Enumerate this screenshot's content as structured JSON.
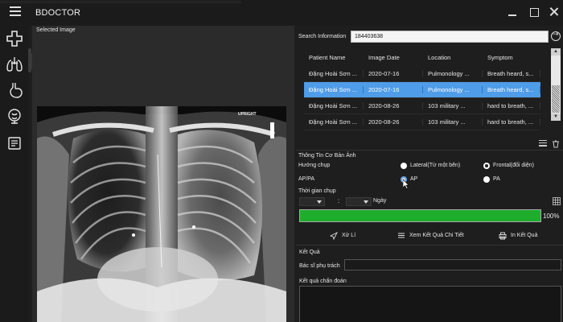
{
  "app": {
    "title": "BDOCTOR"
  },
  "window_controls": {
    "minimize": "minimize-icon",
    "maximize": "maximize-icon",
    "close": "close-icon"
  },
  "sidebar": {
    "items": [
      {
        "name": "add-icon"
      },
      {
        "name": "lungs-icon"
      },
      {
        "name": "stomach-icon"
      },
      {
        "name": "organ-icon"
      },
      {
        "name": "report-icon"
      }
    ]
  },
  "image_panel": {
    "label": "Selected Image",
    "marker": "UPRIGHT"
  },
  "search": {
    "label": "Search Information",
    "value": "184403638"
  },
  "table": {
    "headers": [
      "Patient Name",
      "Image Date",
      "Location",
      "Symptom"
    ],
    "rows": [
      {
        "name": "Đặng Hoài Sơn ...",
        "date": "2020-07-16",
        "location": "Pulmonology ...",
        "symptom": "Breath heard, s...",
        "selected": false
      },
      {
        "name": "Đặng Hoài Sơn ...",
        "date": "2020-07-16",
        "location": "Pulmonology ...",
        "symptom": "Breath heard, s...",
        "selected": true
      },
      {
        "name": "Đặng Hoài Sơn ...",
        "date": "2020-08-26",
        "location": "103 military ...",
        "symptom": "hard to breath, ...",
        "selected": false
      },
      {
        "name": "Đặng Hoài Sơn ...",
        "date": "2020-08-26",
        "location": "103 military ...",
        "symptom": "hard to breath, ...",
        "selected": false
      }
    ]
  },
  "basic_info": {
    "title": "Thông Tin Cơ Bản Ảnh",
    "direction_label": "Hướng chụp",
    "direction_options": [
      "Lateral(Từ một bên)",
      "Frontal(đối diện)"
    ],
    "apa_label": "AP/PA",
    "apa_options": [
      "AP",
      "PA"
    ],
    "time_label": "Thời gian chụp",
    "time_colon": ":",
    "day_label": "Ngày"
  },
  "progress": {
    "value": 100,
    "text": "100%",
    "color": "#1fad2e"
  },
  "actions": {
    "process": "Xử Lí",
    "view_details": "Xem Kết Quả Chi Tiết",
    "print": "In Kết Quả"
  },
  "result": {
    "title": "Kết Quả",
    "doctor_label": "Bác sĩ phụ trách",
    "doctor_value": "",
    "diagnosis_label": "Kết quả chẩn đoán",
    "diagnosis_value": ""
  },
  "colors": {
    "selected_row": "#4f9ce8",
    "background": "#1e1e1e"
  }
}
